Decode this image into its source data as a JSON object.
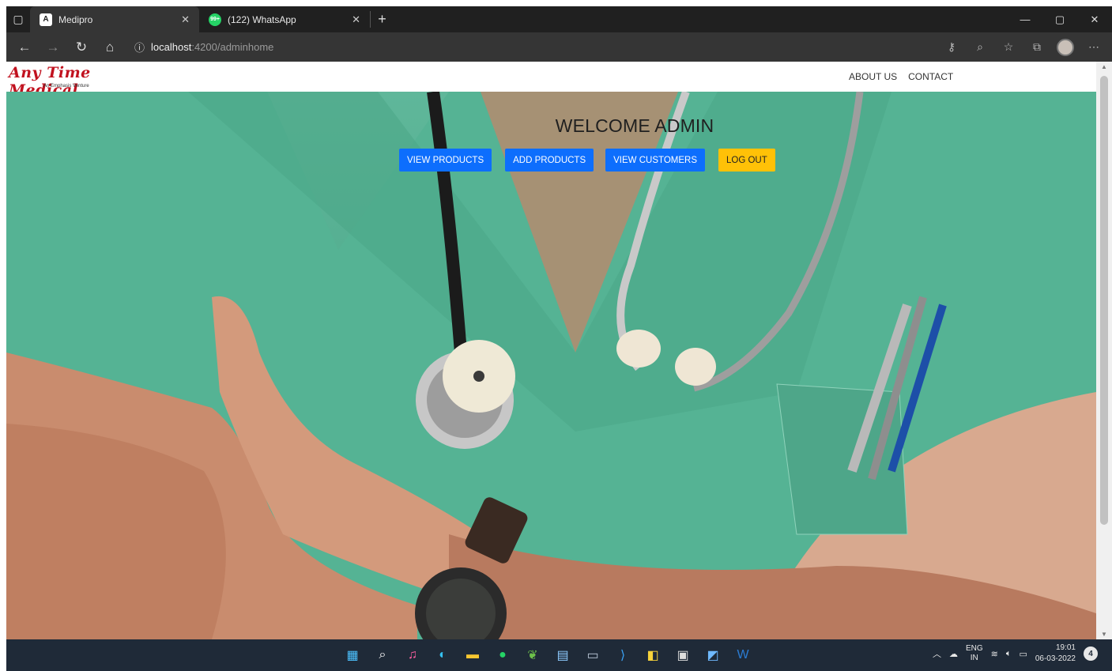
{
  "browser": {
    "tabs": [
      {
        "title": "Medipro",
        "icon": "angular-icon",
        "active": true
      },
      {
        "title": "(122) WhatsApp",
        "icon": "whatsapp-icon",
        "active": false
      }
    ],
    "url_host": "localhost",
    "url_path": ":4200/adminhome"
  },
  "site": {
    "logo_text": "Any Time Medical",
    "logo_tagline": "An Emphasis Venture",
    "nav": {
      "about": "ABOUT US",
      "contact": "CONTACT"
    }
  },
  "hero": {
    "welcome": "WELCOME ADMIN",
    "buttons": {
      "view_products": "VIEW PRODUCTS",
      "add_products": "ADD PRODUCTS",
      "view_customers": "VIEW CUSTOMERS",
      "logout": "LOG OUT"
    }
  },
  "taskbar": {
    "lang_top": "ENG",
    "lang_bottom": "IN",
    "time": "19:01",
    "date": "06-03-2022",
    "notifications": "4"
  },
  "colors": {
    "primary": "#0d6efd",
    "warning": "#ffc107",
    "logo_red": "#c1121f"
  }
}
